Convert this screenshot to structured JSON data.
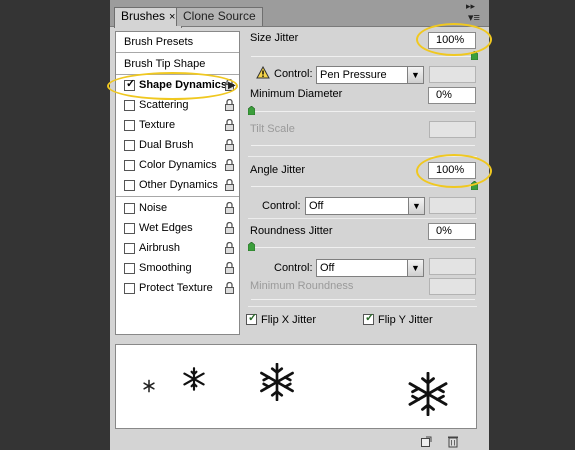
{
  "tabs": [
    {
      "label": "Brushes",
      "active": true,
      "close": "×"
    },
    {
      "label": "Clone Source",
      "active": false
    }
  ],
  "panel_controls": {
    "collapse": "▸▸",
    "menu": "▾≡"
  },
  "left_list": {
    "presets": "Brush Presets",
    "tip_shape": "Brush Tip Shape",
    "options": [
      {
        "label": "Shape Dynamics",
        "checked": true,
        "selected": true
      },
      {
        "label": "Scattering",
        "checked": false
      },
      {
        "label": "Texture",
        "checked": false
      },
      {
        "label": "Dual Brush",
        "checked": false
      },
      {
        "label": "Color Dynamics",
        "checked": false
      },
      {
        "label": "Other Dynamics",
        "checked": false
      },
      {
        "label": "Noise",
        "checked": false
      },
      {
        "label": "Wet Edges",
        "checked": false
      },
      {
        "label": "Airbrush",
        "checked": false
      },
      {
        "label": "Smoothing",
        "checked": false
      },
      {
        "label": "Protect Texture",
        "checked": false
      }
    ]
  },
  "settings": {
    "size_jitter": {
      "label": "Size Jitter",
      "value": "100%"
    },
    "control1": {
      "label": "Control:",
      "value": "Pen Pressure"
    },
    "minimum_diameter": {
      "label": "Minimum Diameter",
      "value": "0%"
    },
    "tilt_scale": {
      "label": "Tilt Scale"
    },
    "angle_jitter": {
      "label": "Angle Jitter",
      "value": "100%"
    },
    "control2": {
      "label": "Control:",
      "value": "Off"
    },
    "roundness_jitter": {
      "label": "Roundness Jitter",
      "value": "0%"
    },
    "control3": {
      "label": "Control:",
      "value": "Off"
    },
    "minimum_roundness": {
      "label": "Minimum Roundness"
    },
    "flip_x": {
      "label": "Flip X Jitter",
      "checked": true
    },
    "flip_y": {
      "label": "Flip Y Jitter",
      "checked": true
    }
  },
  "colors": {
    "highlight": "#f0c820",
    "panel_bg": "#d4d4d4",
    "page_bg": "#343434"
  },
  "icons": {
    "warning": "warning-icon",
    "lock": "lock-icon",
    "new_brush": "new-brush-icon",
    "trash": "trash-icon"
  }
}
